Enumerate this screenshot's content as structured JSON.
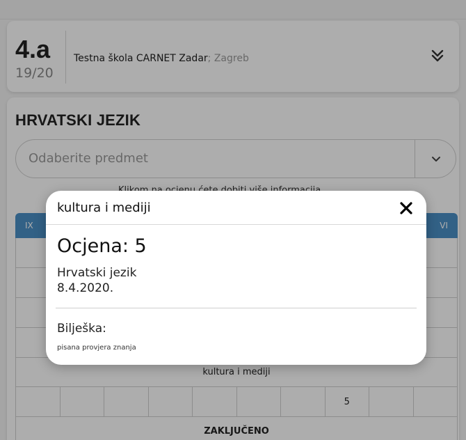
{
  "class_info": {
    "name": "4.a",
    "count": "19/20",
    "school_name": "Testna škola CARNET Zadar",
    "school_city": "; Zagreb"
  },
  "subject": {
    "title": "HRVATSKI JEZIK",
    "select_placeholder": "Odaberite predmet",
    "hint": "Klikom na ocjenu ćete dobiti više informacija"
  },
  "table": {
    "header_first": "IX",
    "header_last": "VI",
    "section_label": "kultura i mediji",
    "grade_cells": [
      "",
      "",
      "",
      "",
      "",
      "",
      "",
      "5",
      "",
      ""
    ],
    "footer_label": "ZAKLJUČENO"
  },
  "modal": {
    "title": "kultura i mediji",
    "close_glyph": "✕",
    "grade_label": "Ocjena: 5",
    "subject": "Hrvatski jezik",
    "date": "8.4.2020.",
    "note_label": "Bilješka:",
    "note_text": "pisana provjera znanja"
  },
  "colors": {
    "table_header": "#4a8fc6",
    "overlay": "rgba(0,0,0,0.32)"
  },
  "icons": {
    "expand": "double-chevron-down-icon",
    "select": "chevron-down-icon",
    "close": "close-icon"
  }
}
